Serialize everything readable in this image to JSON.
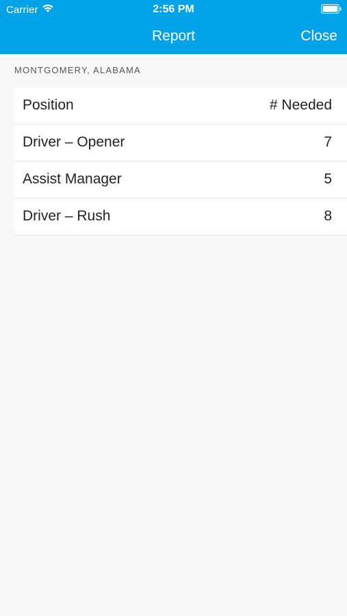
{
  "status_bar": {
    "carrier": "Carrier",
    "time": "2:56 PM",
    "icons": [
      "wifi-icon",
      "battery-icon"
    ]
  },
  "nav": {
    "title": "Report",
    "close_label": "Close",
    "bg_color": "#00a3e8"
  },
  "section": {
    "header": "MONTGOMERY, ALABAMA"
  },
  "table": {
    "columns": [
      "Position",
      "# Needed"
    ],
    "rows": [
      {
        "position": "Driver – Opener",
        "needed": "7"
      },
      {
        "position": "Assist Manager",
        "needed": "5"
      },
      {
        "position": "Driver – Rush",
        "needed": "8"
      }
    ]
  }
}
